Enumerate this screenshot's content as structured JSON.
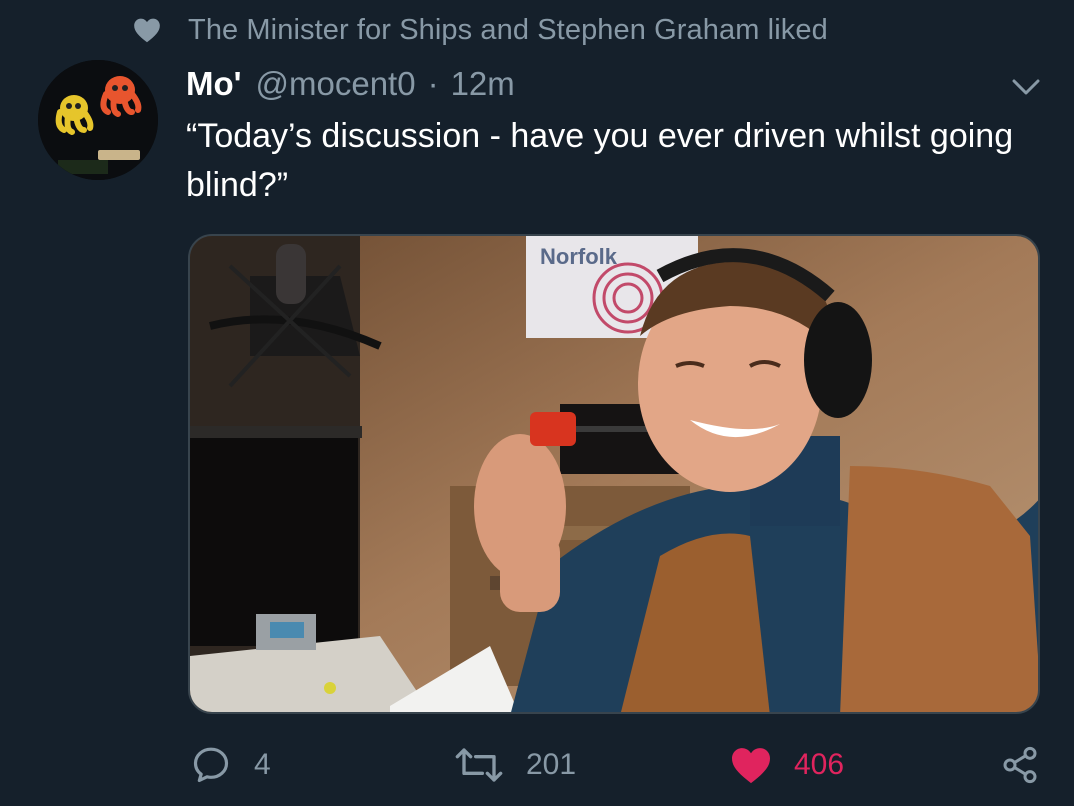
{
  "social_context": {
    "text": "The Minister for Ships and Stephen Graham liked",
    "icon": "heart-icon"
  },
  "tweet": {
    "display_name": "Mo'",
    "handle": "@mocent0",
    "separator": "·",
    "time": "12m",
    "text": "“Today’s discussion - have you ever driven whilst going blind?”",
    "media_sign": "Norfolk"
  },
  "actions": {
    "reply_count": "4",
    "retweet_count": "201",
    "like_count": "406"
  },
  "colors": {
    "background": "#15202b",
    "secondary_text": "#8899a6",
    "like_active": "#e0245e",
    "border": "#38444d"
  }
}
